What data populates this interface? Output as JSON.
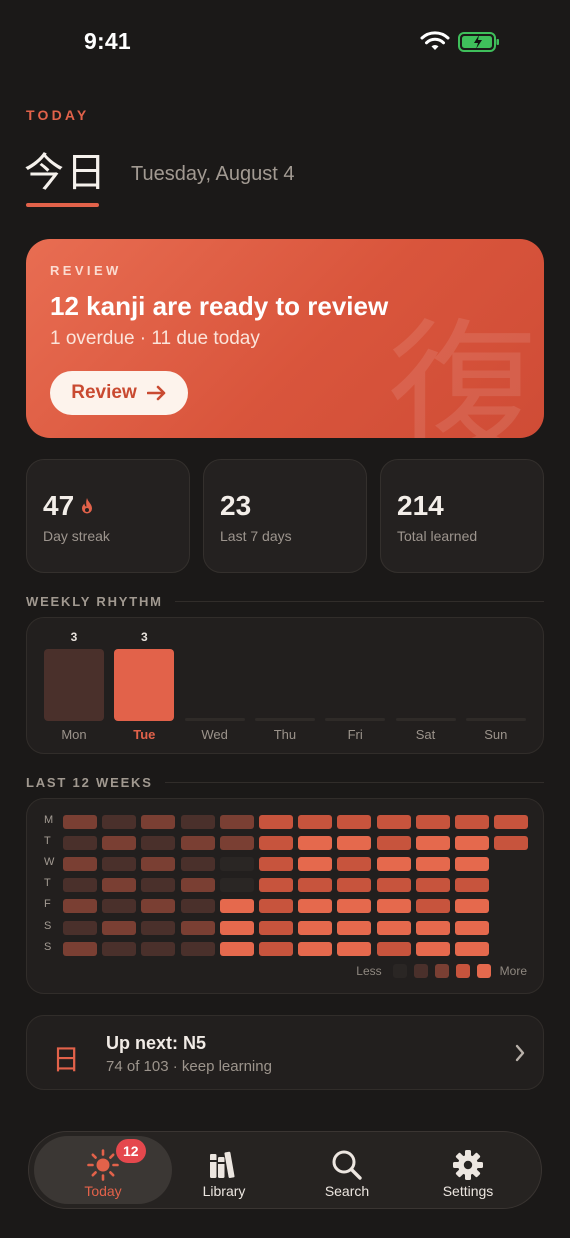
{
  "status_bar": {
    "time": "9:41"
  },
  "header": {
    "eyebrow": "TODAY",
    "kanji_title": "今日",
    "date": "Tuesday, August 4"
  },
  "review_card": {
    "label": "REVIEW",
    "headline": "12 kanji are ready to review",
    "subtitle": "1 overdue · 11 due today",
    "button_label": "Review",
    "watermark": "復"
  },
  "stats": [
    {
      "value": "47",
      "label": "Day streak",
      "icon": "flame-icon"
    },
    {
      "value": "23",
      "label": "Last 7 days"
    },
    {
      "value": "214",
      "label": "Total learned"
    }
  ],
  "weekly_rhythm": {
    "title": "WEEKLY RHYTHM",
    "days": [
      {
        "name": "Mon",
        "count": 3,
        "label": "3",
        "active": false
      },
      {
        "name": "Tue",
        "count": 3,
        "label": "3",
        "active": true
      },
      {
        "name": "Wed",
        "count": 0,
        "label": "",
        "active": false
      },
      {
        "name": "Thu",
        "count": 0,
        "label": "",
        "active": false
      },
      {
        "name": "Fri",
        "count": 0,
        "label": "",
        "active": false
      },
      {
        "name": "Sat",
        "count": 0,
        "label": "",
        "active": false
      },
      {
        "name": "Sun",
        "count": 0,
        "label": "",
        "active": false
      }
    ]
  },
  "heatmap": {
    "title": "LAST 12 WEEKS",
    "row_labels": [
      "M",
      "T",
      "W",
      "T",
      "F",
      "S",
      "S"
    ],
    "levels": [
      [
        2,
        1,
        2,
        1,
        2,
        3,
        3,
        3,
        3,
        3,
        3,
        3
      ],
      [
        1,
        2,
        1,
        2,
        2,
        3,
        4,
        4,
        3,
        4,
        4,
        3
      ],
      [
        2,
        1,
        2,
        1,
        0,
        3,
        4,
        3,
        4,
        4,
        4,
        -1
      ],
      [
        1,
        2,
        1,
        2,
        0,
        3,
        3,
        3,
        3,
        3,
        3,
        -1
      ],
      [
        2,
        1,
        2,
        1,
        4,
        3,
        4,
        4,
        4,
        3,
        4,
        -1
      ],
      [
        1,
        2,
        1,
        2,
        4,
        3,
        4,
        4,
        4,
        4,
        4,
        -1
      ],
      [
        2,
        1,
        1,
        1,
        4,
        3,
        4,
        4,
        3,
        4,
        4,
        -1
      ]
    ],
    "legend_less": "Less",
    "legend_more": "More",
    "colors": [
      "#2a2624",
      "#4a302b",
      "#7a3f33",
      "#c7543d",
      "#e5694d"
    ]
  },
  "up_next": {
    "glyph": "日",
    "title": "Up next: N5",
    "subtitle": "74 of 103 · keep learning"
  },
  "tab_bar": {
    "tabs": [
      {
        "label": "Today",
        "icon": "sun-icon",
        "active": true,
        "badge": "12"
      },
      {
        "label": "Library",
        "icon": "library-icon",
        "active": false
      },
      {
        "label": "Search",
        "icon": "search-icon",
        "active": false
      },
      {
        "label": "Settings",
        "icon": "gear-icon",
        "active": false
      }
    ]
  },
  "accent_color": "#e2624a"
}
